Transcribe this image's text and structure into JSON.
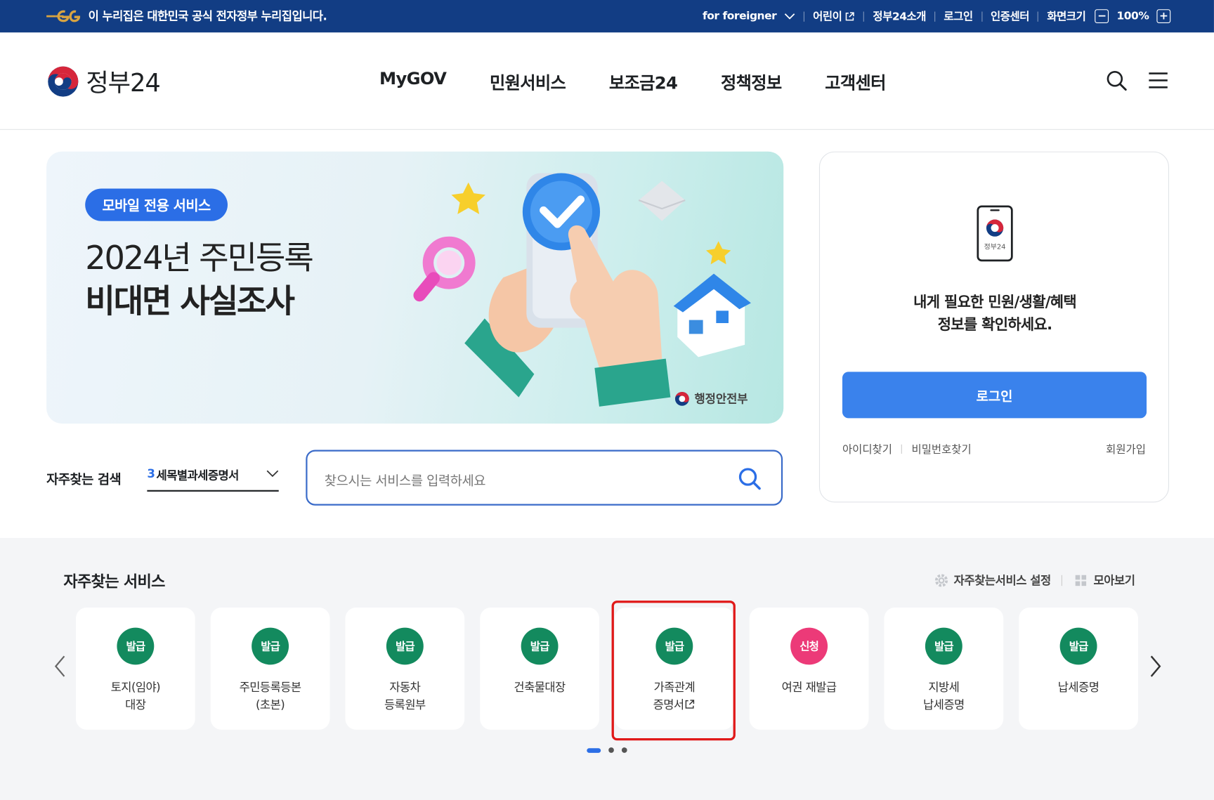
{
  "topbar": {
    "notice": "이 누리집은 대한민국 공식 전자정부 누리집입니다.",
    "for_foreigner": "for foreigner",
    "kids": "어린이",
    "about": "정부24소개",
    "login": "로그인",
    "cert_center": "인증센터",
    "screen_size": "화면크기",
    "zoom_minus": "−",
    "zoom_value": "100%",
    "zoom_plus": "+"
  },
  "header": {
    "logo_text": "정부24",
    "nav": [
      "MyGOV",
      "민원서비스",
      "보조금24",
      "정책정보",
      "고객센터"
    ]
  },
  "banner": {
    "pill": "모바일 전용 서비스",
    "line1": "2024년 주민등록",
    "line2": "비대면 사실조사",
    "credit": "행정안전부"
  },
  "login_box": {
    "phone_label": "정부24",
    "message_line1": "내게 필요한 민원/생활/혜택",
    "message_line2": "정보를 확인하세요.",
    "button": "로그인",
    "find_id": "아이디찾기",
    "find_pw": "비밀번호찾기",
    "join": "회원가입"
  },
  "frequent_search": {
    "label": "자주찾는 검색",
    "selected_rank": "3",
    "selected_value": "세목별과세증명서",
    "placeholder": "찾으시는 서비스를 입력하세요"
  },
  "services": {
    "title": "자주찾는 서비스",
    "settings": "자주찾는서비스 설정",
    "view_all": "모아보기",
    "items": [
      {
        "badge": "발급",
        "line1": "토지(임야)",
        "line2": "대장"
      },
      {
        "badge": "발급",
        "line1": "주민등록등본",
        "line2": "(초본)"
      },
      {
        "badge": "발급",
        "line1": "자동차",
        "line2": "등록원부"
      },
      {
        "badge": "발급",
        "line1": "건축물대장",
        "line2": ""
      },
      {
        "badge": "발급",
        "line1": "가족관계",
        "line2": "증명서"
      },
      {
        "badge": "신청",
        "line1": "여권 재발급",
        "line2": ""
      },
      {
        "badge": "발급",
        "line1": "지방세",
        "line2": "납세증명"
      },
      {
        "badge": "발급",
        "line1": "납세증명",
        "line2": ""
      }
    ]
  },
  "colors": {
    "topbar": "#123d84",
    "accent": "#2b6ee6",
    "login_button": "#3a82ec",
    "badge_issue": "#138a5e",
    "badge_apply": "#ec3a78",
    "highlight": "#e01919"
  },
  "icons": {
    "search": "search-icon",
    "menu": "hamburger-menu-icon",
    "external": "external-link-icon",
    "prev": "chevron-left-icon",
    "next": "chevron-right-icon"
  }
}
